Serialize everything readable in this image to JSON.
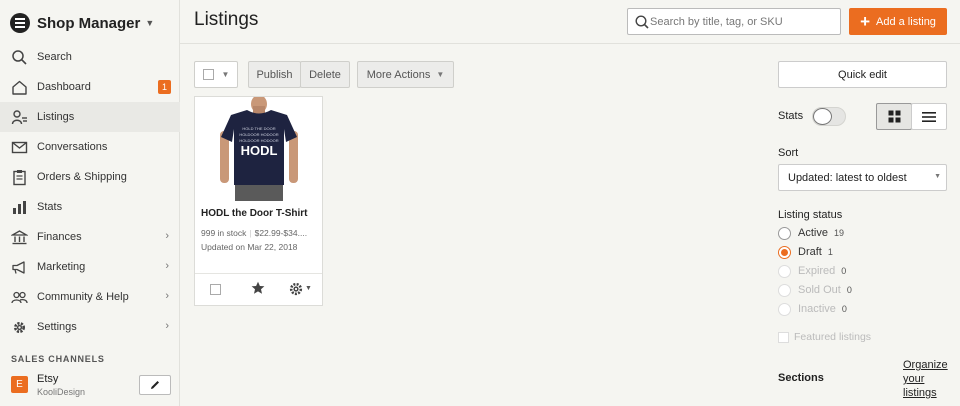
{
  "app": {
    "title": "Shop Manager"
  },
  "sidebar": {
    "items": [
      {
        "label": "Search",
        "icon": "search-icon"
      },
      {
        "label": "Dashboard",
        "icon": "home-icon",
        "badge": "1"
      },
      {
        "label": "Listings",
        "icon": "listings-icon",
        "active": true
      },
      {
        "label": "Conversations",
        "icon": "mail-icon"
      },
      {
        "label": "Orders & Shipping",
        "icon": "clipboard-icon"
      },
      {
        "label": "Stats",
        "icon": "bar-chart-icon"
      },
      {
        "label": "Finances",
        "icon": "bank-icon",
        "chevron": "›"
      },
      {
        "label": "Marketing",
        "icon": "megaphone-icon",
        "chevron": "›"
      },
      {
        "label": "Community & Help",
        "icon": "people-icon",
        "chevron": "›"
      },
      {
        "label": "Settings",
        "icon": "gear-icon",
        "chevron": "›"
      }
    ],
    "channels_heading": "SALES CHANNELS",
    "channel": {
      "badge": "E",
      "name": "Etsy",
      "shop": "KooliDesign"
    }
  },
  "header": {
    "title": "Listings",
    "search_placeholder": "Search by title, tag, or SKU",
    "add_label": "Add a listing"
  },
  "toolbar": {
    "publish_label": "Publish",
    "delete_label": "Delete",
    "more_label": "More Actions"
  },
  "listing": {
    "title": "HODL the Door T-Shirt",
    "stock": "999 in stock",
    "price": "$22.99-$34....",
    "updated": "Updated on Mar 22, 2018",
    "shirt_text": {
      "line1": "HOLD THE DOOR",
      "line2": "HOLDOOR HODOOR",
      "line3": "HOLDOOR HODOOR",
      "main": "HODL"
    }
  },
  "panel": {
    "quick_edit_label": "Quick edit",
    "stats_label": "Stats",
    "sort_heading": "Sort",
    "sort_value": "Updated: latest to oldest",
    "status_heading": "Listing status",
    "statuses": [
      {
        "label": "Active",
        "count": "19"
      },
      {
        "label": "Draft",
        "count": "1",
        "checked": true
      },
      {
        "label": "Expired",
        "count": "0",
        "disabled": true
      },
      {
        "label": "Sold Out",
        "count": "0",
        "disabled": true
      },
      {
        "label": "Inactive",
        "count": "0",
        "disabled": true
      }
    ],
    "featured_label": "Featured listings",
    "sections_label": "Sections",
    "organize_line1": "Organize",
    "organize_line2": "your",
    "organize_line3": "listings"
  },
  "colors": {
    "accent": "#eb6d20",
    "background": "#f5f5f1",
    "shirt": "#1e2340"
  }
}
